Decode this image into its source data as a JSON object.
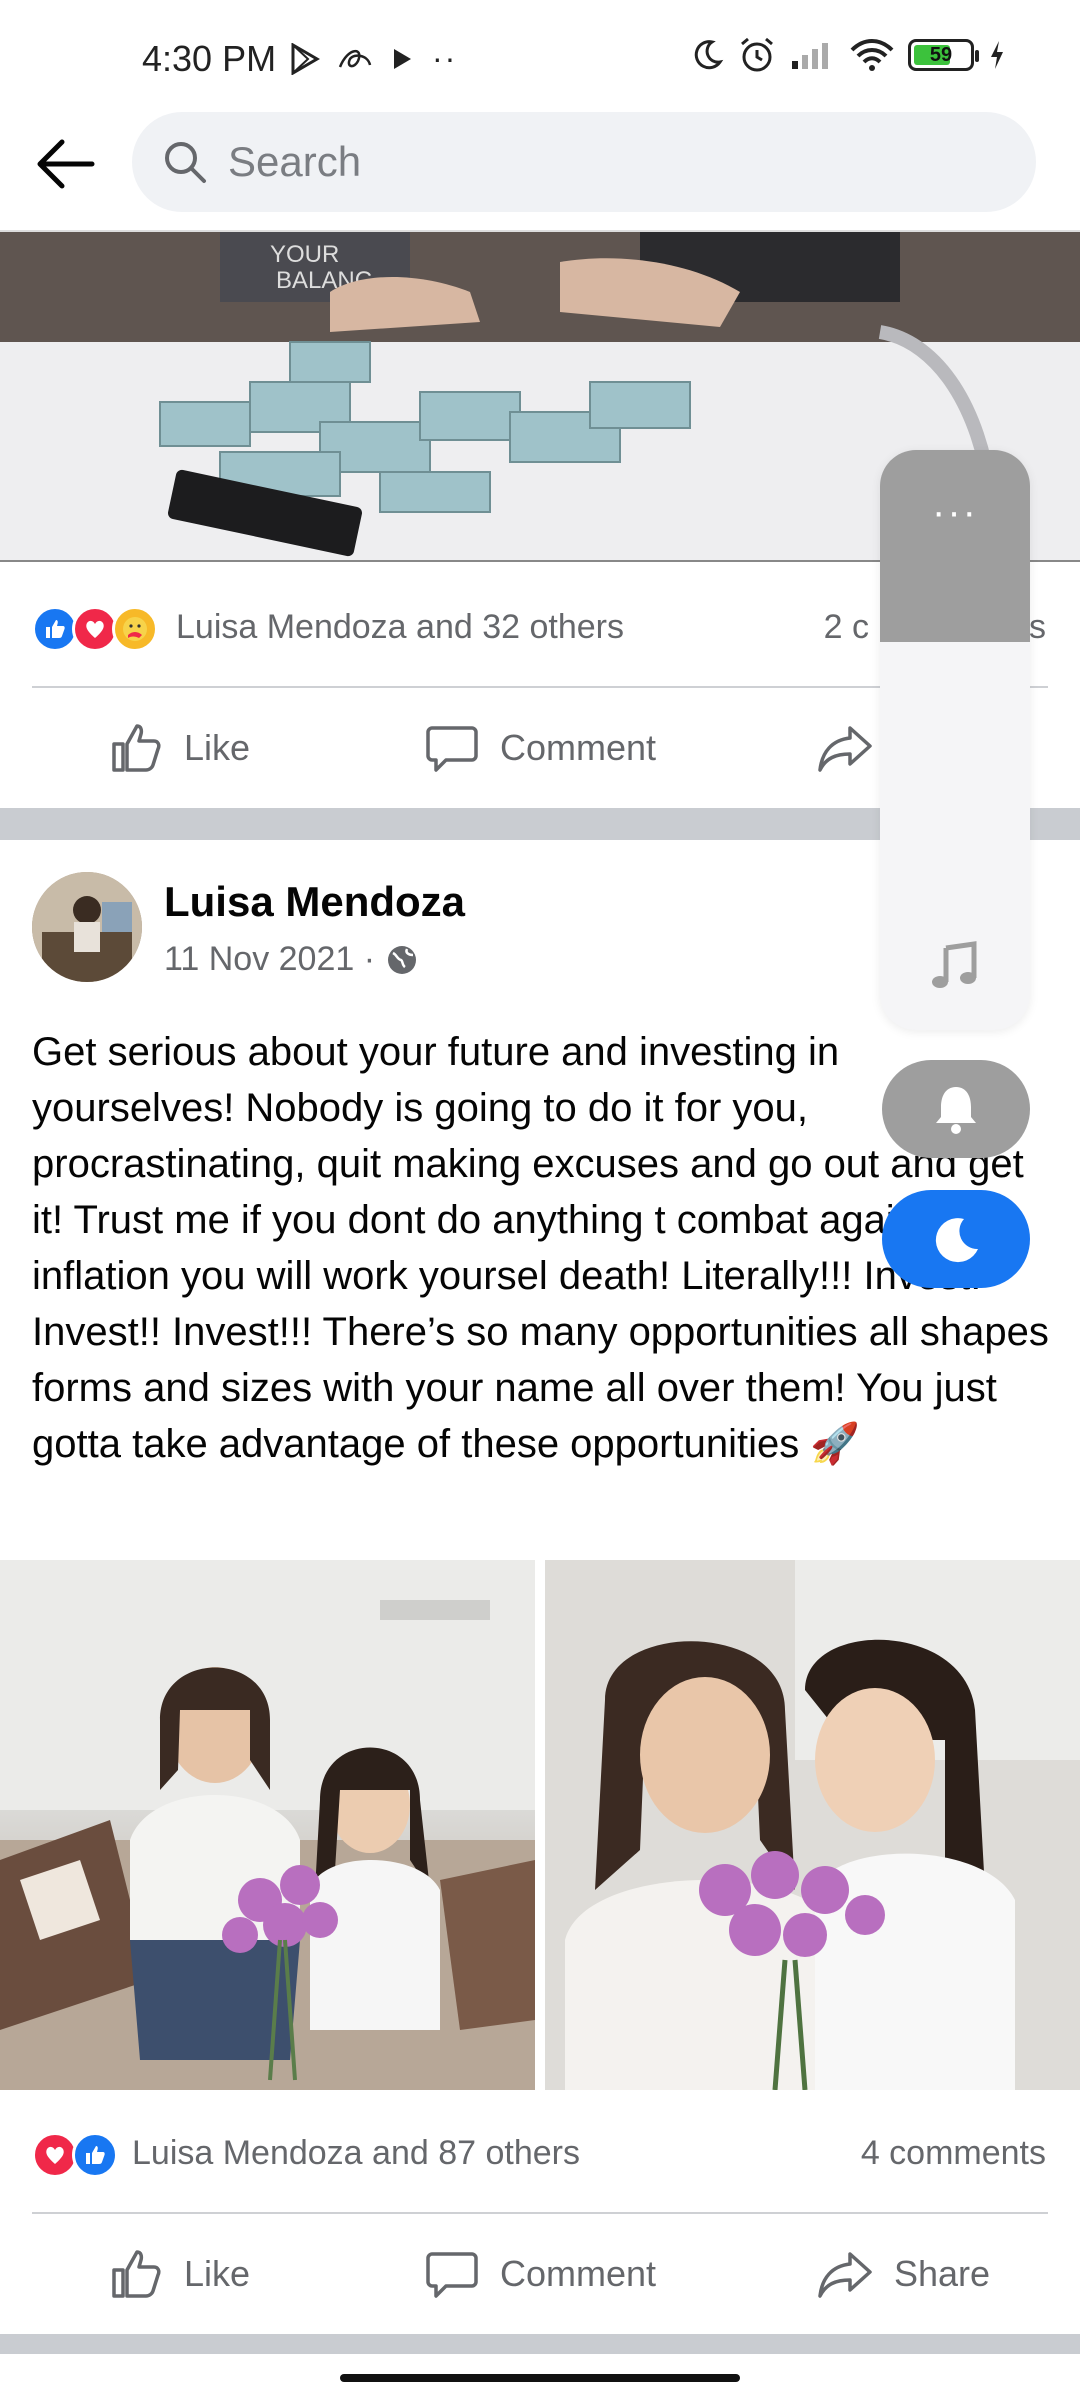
{
  "status_bar": {
    "time": "4:30 PM",
    "battery": "59",
    "icons": [
      "play-store-icon",
      "cursive-a-icon",
      "play-icon",
      "more-dots-icon",
      "moon-icon",
      "alarm-icon",
      "signal-icon",
      "wifi-icon",
      "battery-icon",
      "charging-icon"
    ]
  },
  "header": {
    "search_placeholder": "Search"
  },
  "post1": {
    "reactions": [
      "like",
      "love",
      "care"
    ],
    "reaction_text": "Luisa Mendoza and 32 others",
    "comments_text": "2 c",
    "comments_text_tail": "s",
    "actions": {
      "like": "Like",
      "comment": "Comment"
    }
  },
  "post2": {
    "author": "Luisa Mendoza",
    "date": "11 Nov 2021 ·",
    "text": "Get serious about your future and investing in yourselves! Nobody is going to do it for you, procrastinating, quit making excuses and go out and get it! Trust me if you dont do anything t combat against inflation you will work yoursel death! Literally!!! Invest! Invest!! Invest!!! There’s so many opportunities all shapes forms and sizes with your name all over them! You just gotta take advantage of these opportunities 🚀",
    "reactions": [
      "love",
      "like"
    ],
    "reaction_text": "Luisa Mendoza and 87 others",
    "comments_text": "4 comments",
    "actions": {
      "like": "Like",
      "comment": "Comment",
      "share": "Share"
    }
  },
  "floating_panel": {
    "menu_label": "···",
    "icons": [
      "more-dots-icon",
      "music-note-icon",
      "bell-icon",
      "moon-icon"
    ],
    "active_color": "#1877f2"
  },
  "colors": {
    "brand_blue": "#1877f2",
    "love_red": "#f02849",
    "care_yellow": "#f7b928",
    "secondary_text": "#65676b"
  }
}
